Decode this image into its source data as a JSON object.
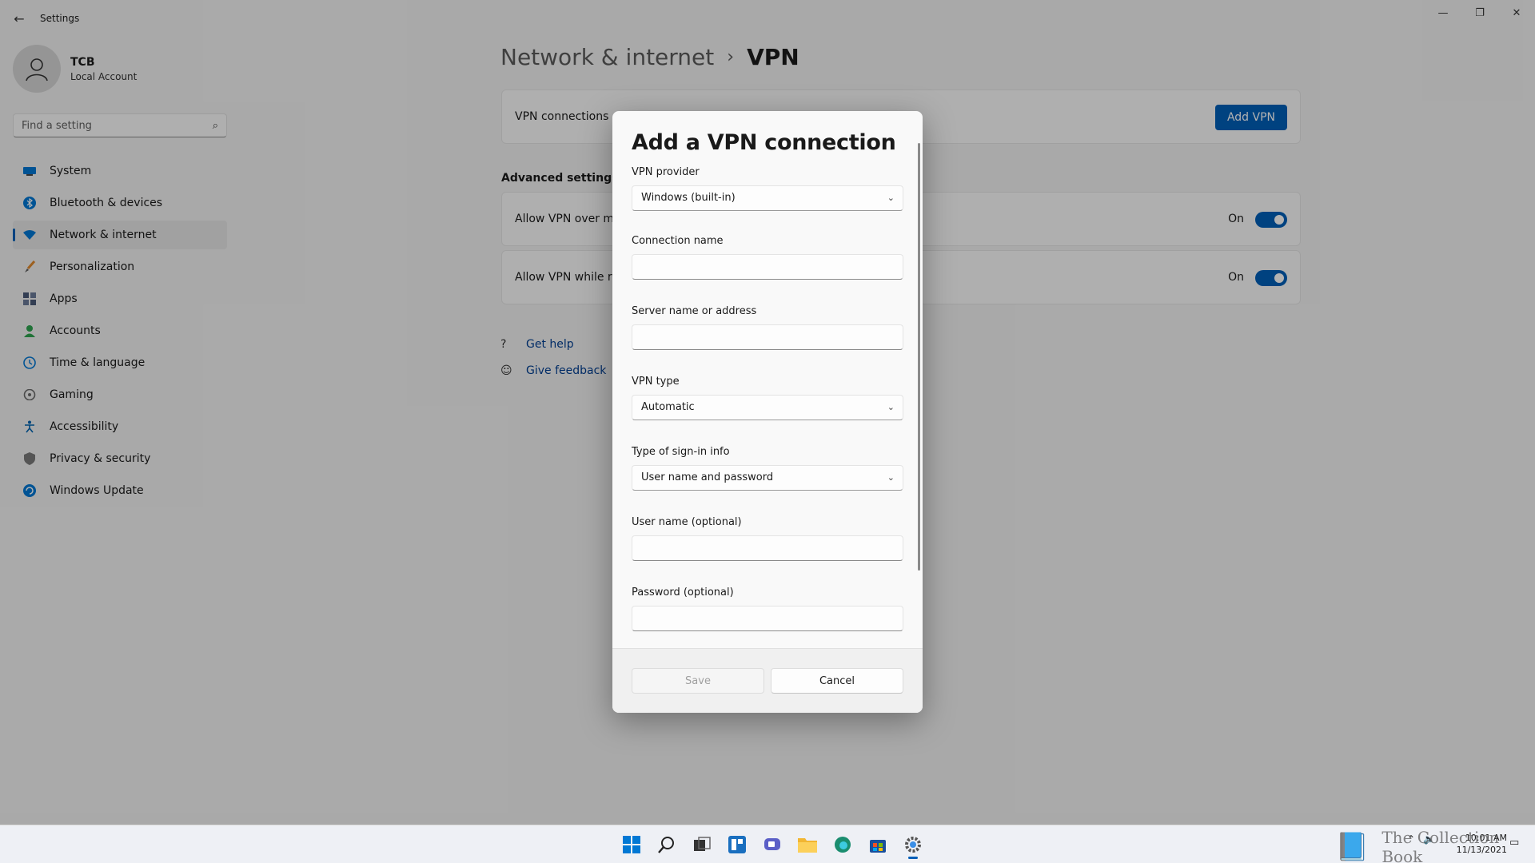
{
  "window": {
    "title": "Settings",
    "back_icon": "back-arrow-icon",
    "controls": {
      "minimize": "—",
      "maximize": "❐",
      "close": "✕"
    }
  },
  "profile": {
    "name": "TCB",
    "subtitle": "Local Account"
  },
  "search": {
    "placeholder": "Find a setting"
  },
  "sidebar": {
    "items": [
      {
        "label": "System",
        "icon": "system-icon",
        "color": "#0078d4"
      },
      {
        "label": "Bluetooth & devices",
        "icon": "bluetooth-icon",
        "color": "#0078d4"
      },
      {
        "label": "Network & internet",
        "icon": "wifi-icon",
        "color": "#0078d4",
        "active": true
      },
      {
        "label": "Personalization",
        "icon": "brush-icon",
        "color": "#e08a2f"
      },
      {
        "label": "Apps",
        "icon": "apps-icon",
        "color": "#4a5a78"
      },
      {
        "label": "Accounts",
        "icon": "account-icon",
        "color": "#2ea44f"
      },
      {
        "label": "Time & language",
        "icon": "globe-clock-icon",
        "color": "#0078d4"
      },
      {
        "label": "Gaming",
        "icon": "gamepad-icon",
        "color": "#6b6b6b"
      },
      {
        "label": "Accessibility",
        "icon": "accessibility-icon",
        "color": "#0063b1"
      },
      {
        "label": "Privacy & security",
        "icon": "shield-icon",
        "color": "#6b6b6b"
      },
      {
        "label": "Windows Update",
        "icon": "update-icon",
        "color": "#0078d4"
      }
    ]
  },
  "breadcrumb": {
    "parent": "Network & internet",
    "separator": "›",
    "current": "VPN"
  },
  "vpn_card": {
    "label": "VPN connections",
    "add_button": "Add VPN"
  },
  "advanced": {
    "heading": "Advanced settings for",
    "toggles": [
      {
        "label": "Allow VPN over met",
        "state": "On"
      },
      {
        "label": "Allow VPN while roa",
        "state": "On"
      }
    ]
  },
  "help": {
    "get_help": "Get help",
    "give_feedback": "Give feedback"
  },
  "dialog": {
    "title": "Add a VPN connection",
    "provider_label": "VPN provider",
    "provider_value": "Windows (built-in)",
    "connection_name_label": "Connection name",
    "connection_name_value": "",
    "server_label": "Server name or address",
    "server_value": "",
    "vpn_type_label": "VPN type",
    "vpn_type_value": "Automatic",
    "signin_label": "Type of sign-in info",
    "signin_value": "User name and password",
    "username_label": "User name (optional)",
    "username_value": "",
    "password_label": "Password (optional)",
    "password_value": "",
    "save_button": "Save",
    "cancel_button": "Cancel"
  },
  "taskbar": {
    "icons": [
      "windows-start-icon",
      "search-icon",
      "task-view-icon",
      "widgets-icon",
      "chat-icon",
      "file-explorer-icon",
      "edge-icon",
      "store-icon",
      "settings-icon"
    ],
    "active": "settings-icon",
    "time": "10:01 AM",
    "date": "11/13/2021"
  },
  "watermark": {
    "text": "The Collection Book"
  },
  "colors": {
    "accent": "#005fb8",
    "link": "#003e92"
  }
}
